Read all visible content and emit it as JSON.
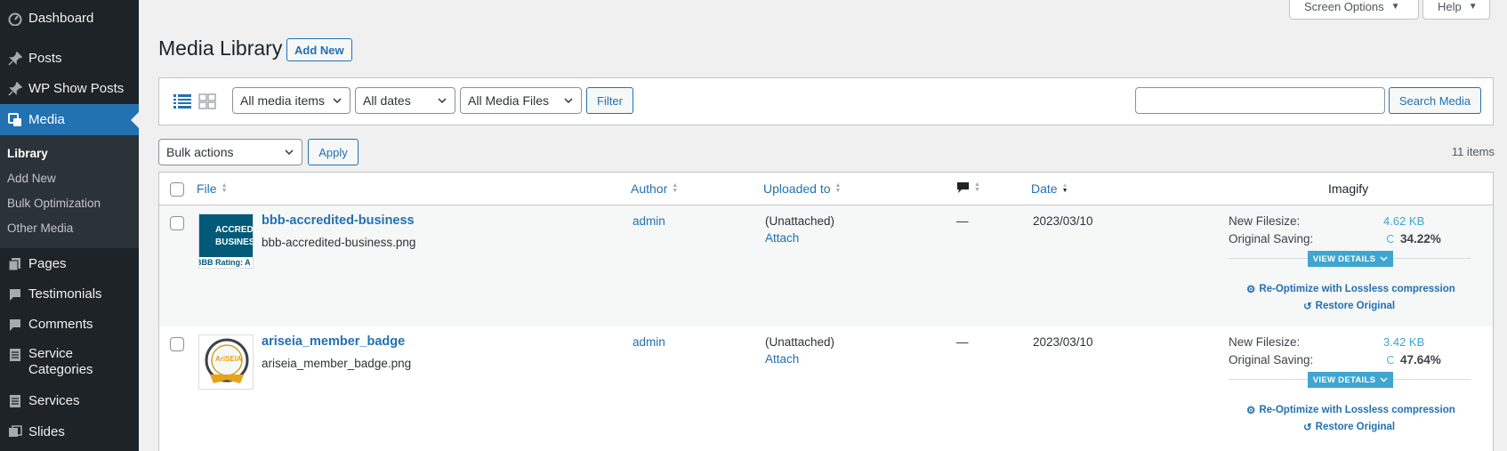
{
  "sidebar": {
    "items": [
      {
        "label": "Dashboard",
        "icon": "dashboard-icon"
      },
      {
        "label": "Posts",
        "icon": "pin-icon"
      },
      {
        "label": "WP Show Posts",
        "icon": "pin-icon"
      },
      {
        "label": "Media",
        "icon": "media-icon"
      },
      {
        "label": "Pages",
        "icon": "pages-icon"
      },
      {
        "label": "Testimonials",
        "icon": "comment-icon"
      },
      {
        "label": "Comments",
        "icon": "comment-icon"
      },
      {
        "label": "Service Categories",
        "icon": "list-icon"
      },
      {
        "label": "Services",
        "icon": "list-icon"
      },
      {
        "label": "Slides",
        "icon": "gallery-icon"
      }
    ],
    "submenu": [
      "Library",
      "Add New",
      "Bulk Optimization",
      "Other Media"
    ]
  },
  "top": {
    "screen_options": "Screen Options",
    "help": "Help"
  },
  "page": {
    "title": "Media Library",
    "add_new": "Add New"
  },
  "filters": {
    "media_type": "All media items",
    "dates": "All dates",
    "media_files": "All Media Files",
    "filter_button": "Filter",
    "search_button": "Search Media",
    "search_value": ""
  },
  "bulk": {
    "selected": "Bulk actions",
    "apply": "Apply",
    "count": "11 items"
  },
  "table": {
    "headers": {
      "file": "File",
      "author": "Author",
      "uploaded_to": "Uploaded to",
      "date": "Date",
      "imagify": "Imagify"
    },
    "rows": [
      {
        "title": "bbb-accredited-business",
        "filename": "bbb-accredited-business.png",
        "author": "admin",
        "uploaded": "(Unattached)",
        "attach": "Attach",
        "comments": "—",
        "date": "2023/03/10",
        "new_filesize_label": "New Filesize:",
        "new_filesize": "4.62 KB",
        "saving_label": "Original Saving:",
        "saving": "34.22%",
        "saving_fraction": 0.3422,
        "view_details": "VIEW DETAILS",
        "reoptimize": "Re-Optimize with Lossless compression",
        "restore": "Restore Original",
        "thumb_text1": "ACCREDITED",
        "thumb_text2": "BUSINESS",
        "thumb_text3": "BBB Rating: A"
      },
      {
        "title": "ariseia_member_badge",
        "filename": "ariseia_member_badge.png",
        "author": "admin",
        "uploaded": "(Unattached)",
        "attach": "Attach",
        "comments": "—",
        "date": "2023/03/10",
        "new_filesize_label": "New Filesize:",
        "new_filesize": "3.42 KB",
        "saving_label": "Original Saving:",
        "saving": "47.64%",
        "saving_fraction": 0.4764,
        "view_details": "VIEW DETAILS",
        "reoptimize": "Re-Optimize with Lossless compression",
        "restore": "Restore Original",
        "thumb_text1": "AriSEIA"
      }
    ]
  },
  "colors": {
    "accent": "#2271b1",
    "imagify": "#3fa6d0",
    "sidebar": "#1d2327"
  }
}
